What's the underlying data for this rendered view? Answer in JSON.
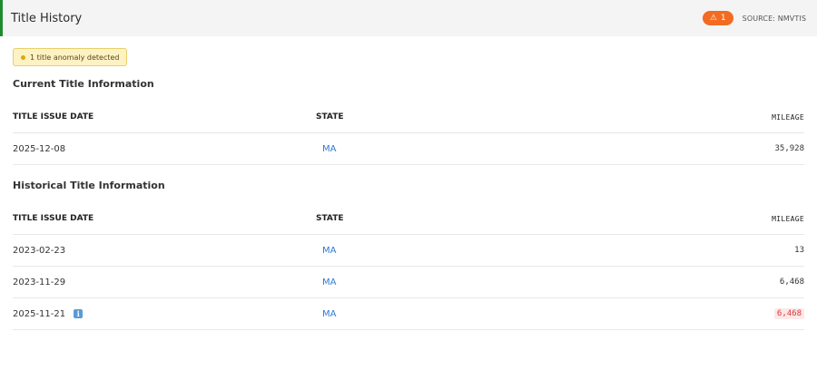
{
  "header": {
    "title": "Title History",
    "alert_count": "1",
    "source": "SOURCE: NMVTIS",
    "accent_color": "#1f8a2e",
    "badge_color": "#f26b21"
  },
  "anomaly": {
    "text": "1 title anomaly detected"
  },
  "current": {
    "title": "Current Title Information",
    "columns": [
      "TITLE ISSUE DATE",
      "STATE",
      "MILEAGE"
    ],
    "rows": [
      {
        "date": "2025-12-08",
        "state": "MA",
        "mileage": "35,928"
      }
    ]
  },
  "historical": {
    "title": "Historical Title Information",
    "columns": [
      "TITLE ISSUE DATE",
      "STATE",
      "MILEAGE"
    ],
    "rows": [
      {
        "date": "2023-02-23",
        "state": "MA",
        "mileage": "13"
      },
      {
        "date": "2023-11-29",
        "state": "MA",
        "mileage": "6,468"
      },
      {
        "date": "2025-11-21",
        "state": "MA",
        "mileage": "6,468",
        "info_icon": "info-icon",
        "flagged": true
      }
    ]
  }
}
